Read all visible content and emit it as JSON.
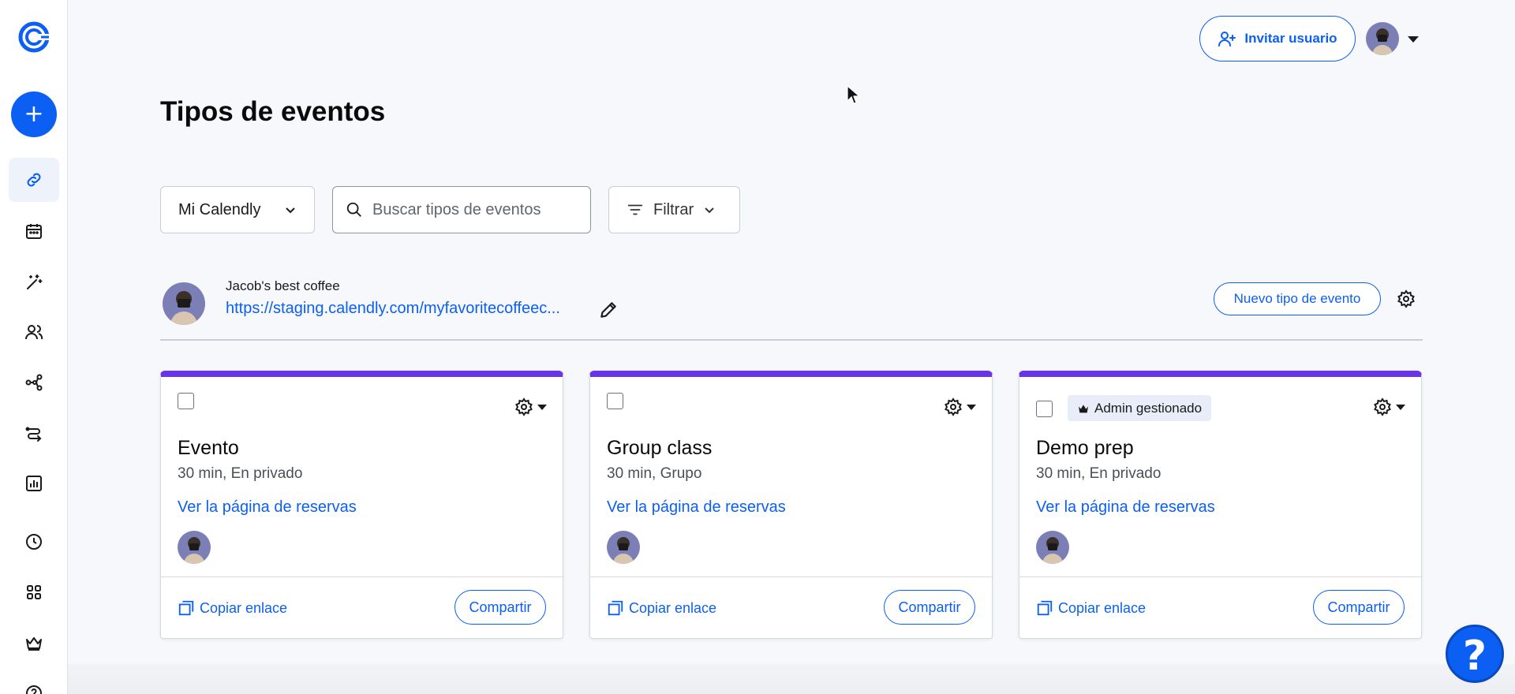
{
  "header": {
    "invite_label": "Invitar usuario"
  },
  "sidebar": {
    "create_label": "+",
    "items": [
      {
        "name": "event-types",
        "icon": "link-icon",
        "active": true
      },
      {
        "name": "meetings",
        "icon": "calendar-icon"
      },
      {
        "name": "ai",
        "icon": "magic-wand-icon"
      },
      {
        "name": "contacts",
        "icon": "users-icon"
      },
      {
        "name": "workflows",
        "icon": "workflow-icon"
      },
      {
        "name": "routing",
        "icon": "routing-icon"
      },
      {
        "name": "analytics",
        "icon": "analytics-icon"
      },
      {
        "name": "availability",
        "icon": "clock-icon"
      },
      {
        "name": "integrations",
        "icon": "apps-icon"
      },
      {
        "name": "admin",
        "icon": "crown-icon"
      }
    ]
  },
  "main": {
    "title": "Tipos de eventos",
    "filters": {
      "owner_select": "Mi Calendly",
      "search_placeholder": "Buscar tipos de eventos",
      "filter_label": "Filtrar"
    },
    "profile": {
      "name": "Jacob's best coffee",
      "link": "https://staging.calendly.com/myfavoritecoffeec...",
      "new_event_label": "Nuevo tipo de evento"
    },
    "cards": [
      {
        "title": "Evento",
        "meta": "30 min, En privado",
        "view_link": "Ver la página de reservas",
        "copy_label": "Copiar enlace",
        "share_label": "Compartir"
      },
      {
        "title": "Group class",
        "meta": "30 min, Grupo",
        "view_link": "Ver la página de reservas",
        "copy_label": "Copiar enlace",
        "share_label": "Compartir"
      },
      {
        "title": "Demo prep",
        "badge": "Admin gestionado",
        "meta": "30 min, En privado",
        "view_link": "Ver la página de reservas",
        "copy_label": "Copiar enlace",
        "share_label": "Compartir"
      }
    ],
    "help_label": "?"
  },
  "colors": {
    "accent": "#0b5ff2",
    "card_top": "#6a35e6",
    "background": "#f7f8fb"
  }
}
